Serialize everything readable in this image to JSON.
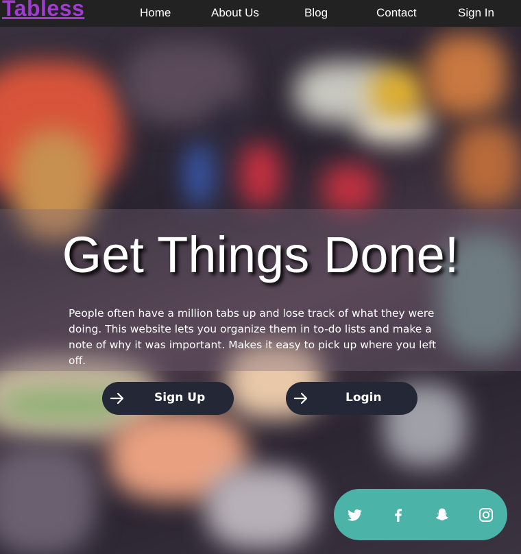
{
  "brand": "Tabless",
  "nav": {
    "home": "Home",
    "about": "About Us",
    "blog": "Blog",
    "contact": "Contact",
    "signin": "Sign In"
  },
  "hero": {
    "headline": "Get Things Done!",
    "description": "People often have a million tabs up and lose track of what they were doing. This website lets you organize them in to-do lists and make a note of why it was important. Makes it easy to pick up where you left off."
  },
  "buttons": {
    "signup": "Sign Up",
    "login": "Login"
  },
  "social": [
    "twitter-icon",
    "facebook-icon",
    "snapchat-icon",
    "instagram-icon"
  ],
  "colors": {
    "brand": "#a23bd1",
    "navbar": "#222222",
    "button": "#242836",
    "social_bar": "#4bb3a8"
  }
}
